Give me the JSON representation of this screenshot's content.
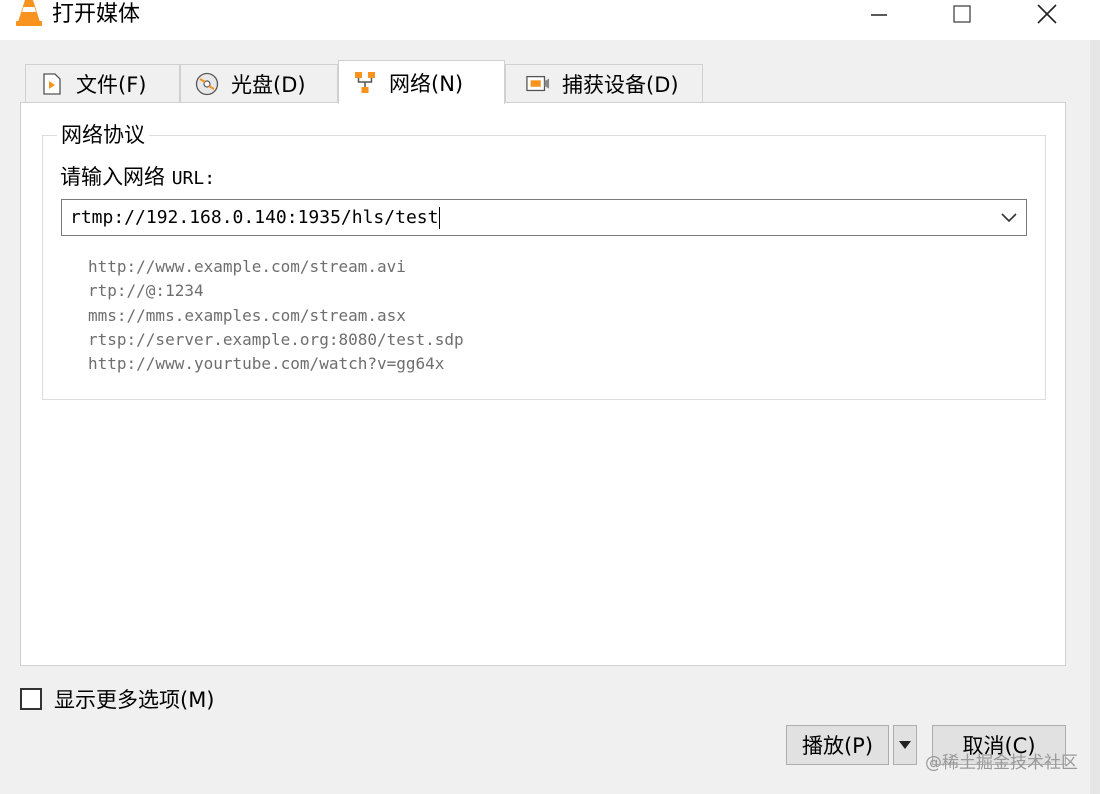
{
  "window": {
    "title": "打开媒体",
    "title_icon": "vlc-cone-icon",
    "controls": [
      "minimize-icon",
      "maximize-icon",
      "close-icon"
    ]
  },
  "tabs": [
    {
      "label": "文件(F)",
      "icon": "file-play-icon",
      "active": false
    },
    {
      "label": "光盘(D)",
      "icon": "disc-icon",
      "active": false
    },
    {
      "label": "网络(N)",
      "icon": "network-icon",
      "active": true
    },
    {
      "label": "捕获设备(D)",
      "icon": "capture-device-icon",
      "active": false
    }
  ],
  "network": {
    "group_title": "网络协议",
    "url_label": "请输入网络",
    "url_label_suffix": "URL:",
    "url_value": "rtmp://192.168.0.140:1935/hls/test",
    "examples": [
      "http://www.example.com/stream.avi",
      "rtp://@:1234",
      "mms://mms.examples.com/stream.asx",
      "rtsp://server.example.org:8080/test.sdp",
      "http://www.yourtube.com/watch?v=gg64x"
    ]
  },
  "footer": {
    "more_options_label": "显示更多选项(M)",
    "more_options_checked": false,
    "play_label": "播放(P)",
    "cancel_label": "取消(C)"
  },
  "watermark": "@稀土掘金技术社区",
  "colors": {
    "vlc_orange": "#f7931e",
    "panel_bg": "#ffffff",
    "dialog_bg": "#f0f0f0",
    "example_text": "#6e6e6e"
  }
}
